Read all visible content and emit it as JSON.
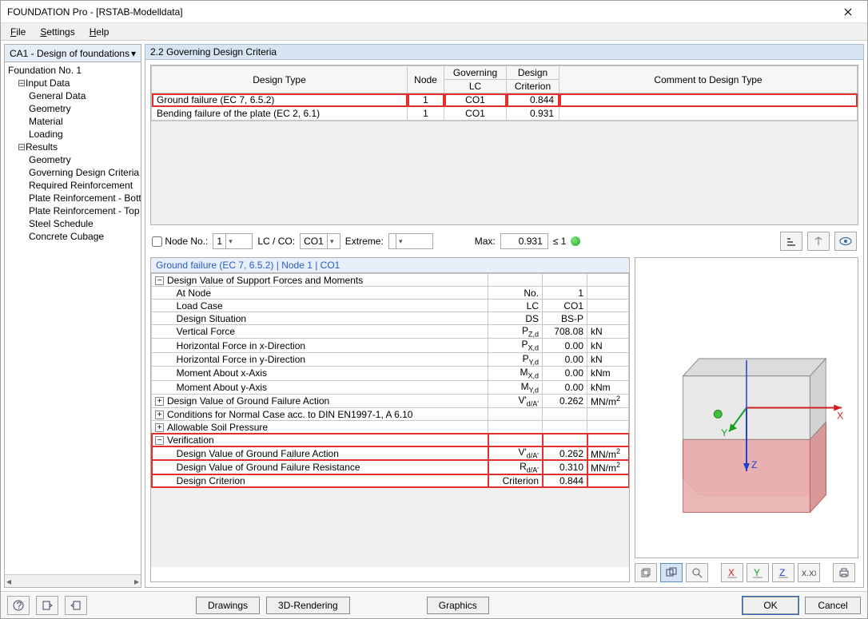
{
  "window": {
    "title": "FOUNDATION Pro - [RSTAB-Modelldata]"
  },
  "menu": {
    "file": "File",
    "settings": "Settings",
    "help": "Help"
  },
  "combo": {
    "selected": "CA1 - Design of foundations"
  },
  "tree": {
    "root": "Foundation No. 1",
    "input": "Input Data",
    "input_items": [
      "General Data",
      "Geometry",
      "Material",
      "Loading"
    ],
    "results": "Results",
    "results_items": [
      "Geometry",
      "Governing Design Criteria",
      "Required Reinforcement",
      "Plate Reinforcement - Bottom",
      "Plate Reinforcement - Top",
      "Steel Schedule",
      "Concrete Cubage"
    ]
  },
  "section": {
    "title": "2.2 Governing Design Criteria"
  },
  "top_table": {
    "headers": {
      "design_type": "Design Type",
      "node": "Node",
      "governing": "Governing",
      "lc": "LC",
      "design": "Design",
      "criterion": "Criterion",
      "comment": "Comment to Design Type"
    },
    "rows": [
      {
        "type": "Ground failure (EC 7, 6.5.2)",
        "node": "1",
        "lc": "CO1",
        "crit": "0.844",
        "hl": true
      },
      {
        "type": "Bending failure of the plate (EC 2, 6.1)",
        "node": "1",
        "lc": "CO1",
        "crit": "0.931",
        "hl": false
      }
    ]
  },
  "filter": {
    "node_lbl": "Node No.:",
    "node_val": "1",
    "lcco_lbl": "LC / CO:",
    "lcco_val": "CO1",
    "extreme_lbl": "Extreme:",
    "extreme_val": "",
    "max_lbl": "Max:",
    "max_val": "0.931",
    "max_cmp": "≤ 1"
  },
  "details": {
    "header": "Ground failure (EC 7, 6.5.2) | Node 1 | CO1",
    "rows": [
      {
        "kind": "group",
        "exp": "−",
        "label": "Design Value of Support Forces and Moments"
      },
      {
        "kind": "row",
        "label": "At Node",
        "sym": "No.",
        "val": "1",
        "unit": ""
      },
      {
        "kind": "row",
        "label": "Load Case",
        "sym": "LC",
        "val": "CO1",
        "unit": ""
      },
      {
        "kind": "row",
        "label": "Design Situation",
        "sym": "DS",
        "val": "BS-P",
        "unit": ""
      },
      {
        "kind": "row",
        "label": "Vertical Force",
        "sym": "P Z,d",
        "val": "708.08",
        "unit": "kN"
      },
      {
        "kind": "row",
        "label": "Horizontal Force in x-Direction",
        "sym": "P X,d",
        "val": "0.00",
        "unit": "kN"
      },
      {
        "kind": "row",
        "label": "Horizontal Force in y-Direction",
        "sym": "P Y,d",
        "val": "0.00",
        "unit": "kN"
      },
      {
        "kind": "row",
        "label": "Moment About x-Axis",
        "sym": "M X,d",
        "val": "0.00",
        "unit": "kNm"
      },
      {
        "kind": "row",
        "label": "Moment About y-Axis",
        "sym": "M Y,d",
        "val": "0.00",
        "unit": "kNm"
      },
      {
        "kind": "group",
        "exp": "+",
        "label": "Design Value of Ground Failure Action",
        "sym": "V'd/A'",
        "val": "0.262",
        "unit": "MN/m²"
      },
      {
        "kind": "group",
        "exp": "+",
        "label": "Conditions for Normal Case acc. to DIN EN1997-1, A 6.10"
      },
      {
        "kind": "group",
        "exp": "+",
        "label": "Allowable Soil Pressure"
      },
      {
        "kind": "group",
        "exp": "−",
        "label": "Verification",
        "sel": true
      },
      {
        "kind": "row",
        "label": "Design Value of Ground Failure Action",
        "sym": "V'd/A'",
        "val": "0.262",
        "unit": "MN/m²",
        "sel": true
      },
      {
        "kind": "row",
        "label": "Design Value of Ground Failure Resistance",
        "sym": "Rd/A'",
        "val": "0.310",
        "unit": "MN/m²",
        "sel": true
      },
      {
        "kind": "row",
        "label": "Design Criterion",
        "sym": "Criterion",
        "val": "0.844",
        "unit": "",
        "sel": true
      }
    ]
  },
  "bottom": {
    "drawings": "Drawings",
    "render": "3D-Rendering",
    "graphics": "Graphics",
    "ok": "OK",
    "cancel": "Cancel"
  }
}
